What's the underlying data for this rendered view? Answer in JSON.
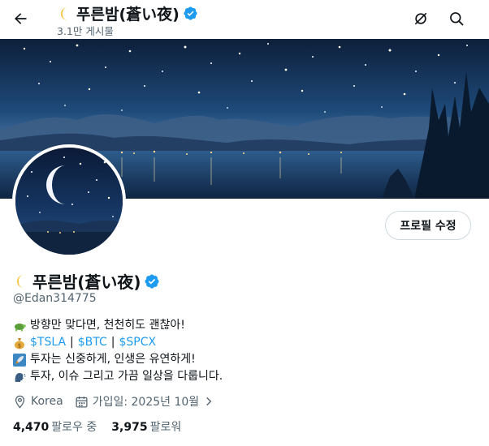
{
  "header": {
    "name": "푸른밤(蒼い夜)",
    "post_count": "3.1만 게시물"
  },
  "profile": {
    "name": "푸른밤(蒼い夜)",
    "handle": "@Edan314775",
    "edit_label": "프로필 수정",
    "bio": {
      "line1": "방향만 맞다면, 천천히도 괜찮아!",
      "cashtags": [
        "$TSLA",
        "$BTC",
        "$SPCX"
      ],
      "separator": "|",
      "line3": "투자는 신중하게, 인생은 유연하게!",
      "line4": "투자, 이슈 그리고 가끔 일상을 다룹니다."
    },
    "location": "Korea",
    "joined": "가입일: 2025년 10월",
    "following_count": "4,470",
    "following_label": "팔로우 중",
    "followers_count": "3,975",
    "followers_label": "팔로워"
  },
  "icons": {
    "back": "arrow-left-icon",
    "hide": "eye-slash-icon",
    "search": "search-icon",
    "verified": "verified-badge-icon",
    "moon": "crescent-moon-emoji",
    "turtle": "turtle-emoji",
    "money": "money-bag-emoji",
    "rocket": "rocket-emoji",
    "speaking": "speaking-head-emoji",
    "location": "location-pin-icon",
    "calendar": "calendar-icon",
    "chevron": "chevron-right-icon"
  },
  "colors": {
    "accent": "#1d9bf0",
    "text": "#0f1419",
    "secondary": "#536471",
    "border": "#cfd9de"
  }
}
